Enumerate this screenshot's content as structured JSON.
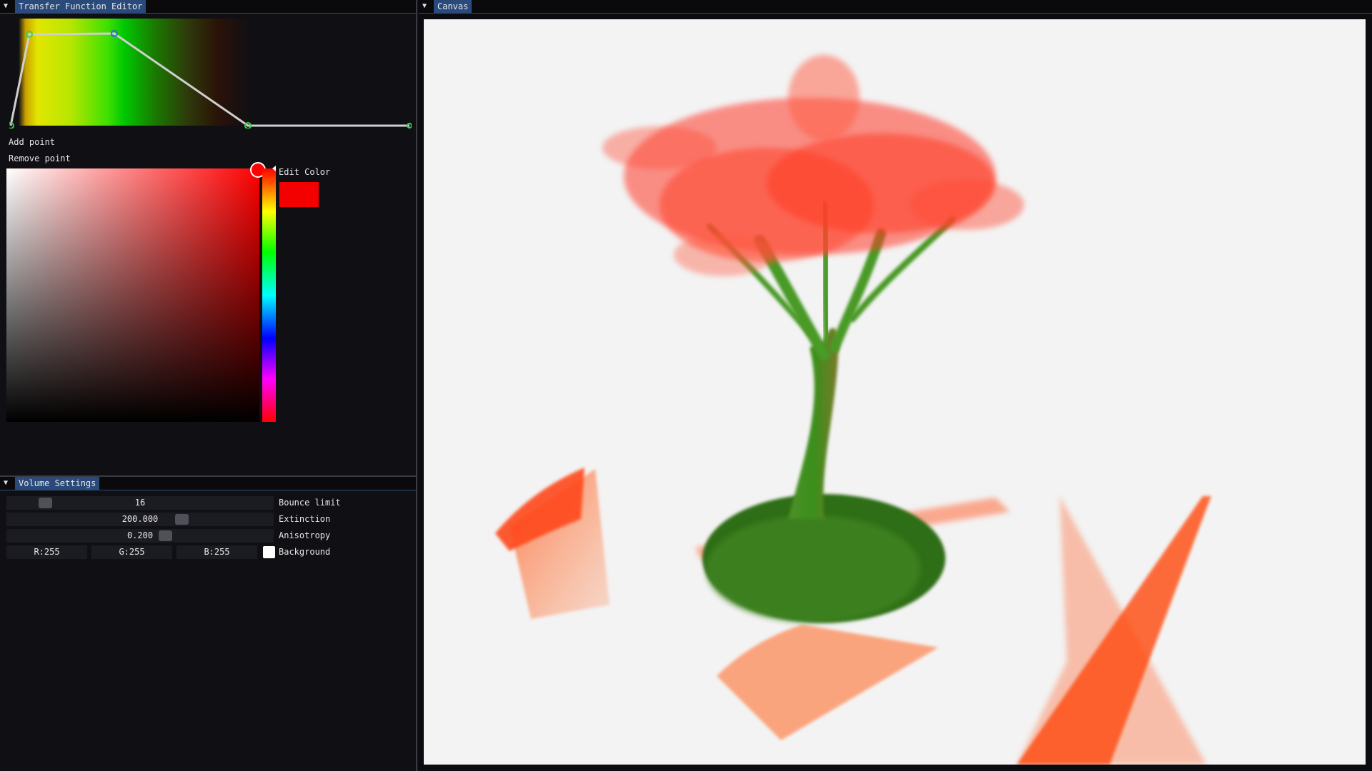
{
  "tf_panel": {
    "title": "Transfer Function Editor",
    "add_point_label": "Add point",
    "remove_point_label": "Remove point",
    "edit_color_label": "Edit Color",
    "selected_color": "#f30000"
  },
  "volume_settings": {
    "title": "Volume Settings",
    "bounce_limit": {
      "value": "16",
      "label": "Bounce limit"
    },
    "extinction": {
      "value": "200.000",
      "label": "Extinction"
    },
    "anisotropy": {
      "value": "0.200",
      "label": "Anisotropy"
    },
    "background": {
      "r": "R:255",
      "g": "G:255",
      "b": "B:255",
      "label": "Background",
      "color": "#ffffff"
    }
  },
  "canvas_panel": {
    "title": "Canvas",
    "background_color": "#f3f3f3"
  },
  "icons": {
    "collapse": "triangle-down-icon"
  }
}
